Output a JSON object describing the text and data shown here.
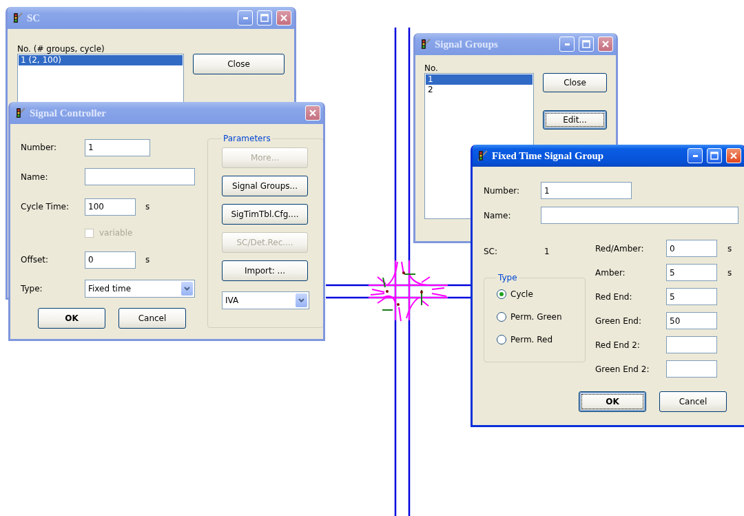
{
  "sc_window": {
    "title": "SC",
    "active": false,
    "min_max_buttons": true,
    "list_label": "No. (# groups, cycle)",
    "items": [
      {
        "label": "1  (2, 100)",
        "selected": true
      }
    ],
    "buttons": [
      {
        "label": "Close",
        "focused": false
      }
    ]
  },
  "signal_groups_window": {
    "title": "Signal Groups",
    "active": false,
    "min_max_buttons": true,
    "list_label": "No.",
    "items": [
      {
        "label": "1",
        "selected": true
      },
      {
        "label": "2",
        "selected": false
      }
    ],
    "buttons": [
      {
        "label": "Close",
        "focused": false
      },
      {
        "label": "Edit...",
        "focused": true
      }
    ]
  },
  "signal_controller": {
    "title": "Signal Controller",
    "active": false,
    "min_max_buttons": false,
    "fields": [
      {
        "kind": "text",
        "label": "Number:",
        "value": "1"
      },
      {
        "kind": "text",
        "label": "Name:"
      },
      {
        "kind": "text",
        "label": "Cycle Time:",
        "value": "100",
        "unit": "s"
      },
      {
        "kind": "checkbox",
        "label": "variable",
        "checked": false,
        "disabled": true
      },
      {
        "kind": "text",
        "label": "Offset:",
        "value": "0",
        "unit": "s"
      },
      {
        "kind": "combo",
        "label": "Type:",
        "value": "Fixed time"
      }
    ],
    "parameters": {
      "title": "Parameters",
      "buttons": [
        {
          "label": "More...",
          "disabled": true
        },
        {
          "label": "Signal Groups...",
          "disabled": false
        },
        {
          "label": "SigTimTbl.Cfg....",
          "disabled": false
        },
        {
          "label": "SC/Det.Rec....",
          "disabled": true
        },
        {
          "label": "Import: ...",
          "disabled": false
        }
      ],
      "combo": "IVA"
    },
    "buttons": [
      {
        "label": "OK",
        "default": true
      },
      {
        "label": "Cancel",
        "default": false
      }
    ]
  },
  "fixed_time_window": {
    "title": "Fixed Time Signal Group",
    "active": true,
    "min_max_buttons": true,
    "number": {
      "label": "Number:",
      "value": "1"
    },
    "name": {
      "label": "Name:"
    },
    "sc": {
      "label": "SC:",
      "value": "1"
    },
    "type_group": {
      "title": "Type",
      "options": [
        {
          "label": "Cycle",
          "selected": true
        },
        {
          "label": "Perm. Green",
          "selected": false
        },
        {
          "label": "Perm. Red",
          "selected": false
        }
      ]
    },
    "timings": [
      {
        "label": "Red/Amber:",
        "value": "0",
        "unit": "s"
      },
      {
        "label": "Amber:",
        "value": "5",
        "unit": "s"
      },
      {
        "label": "Red End:",
        "value": "5"
      },
      {
        "label": "Green End:",
        "value": "50"
      },
      {
        "label": "Red End 2:"
      },
      {
        "label": "Green End 2:"
      }
    ],
    "buttons": [
      {
        "label": "OK",
        "default": true,
        "focused": true
      },
      {
        "label": "Cancel",
        "default": false,
        "focused": false
      }
    ]
  }
}
